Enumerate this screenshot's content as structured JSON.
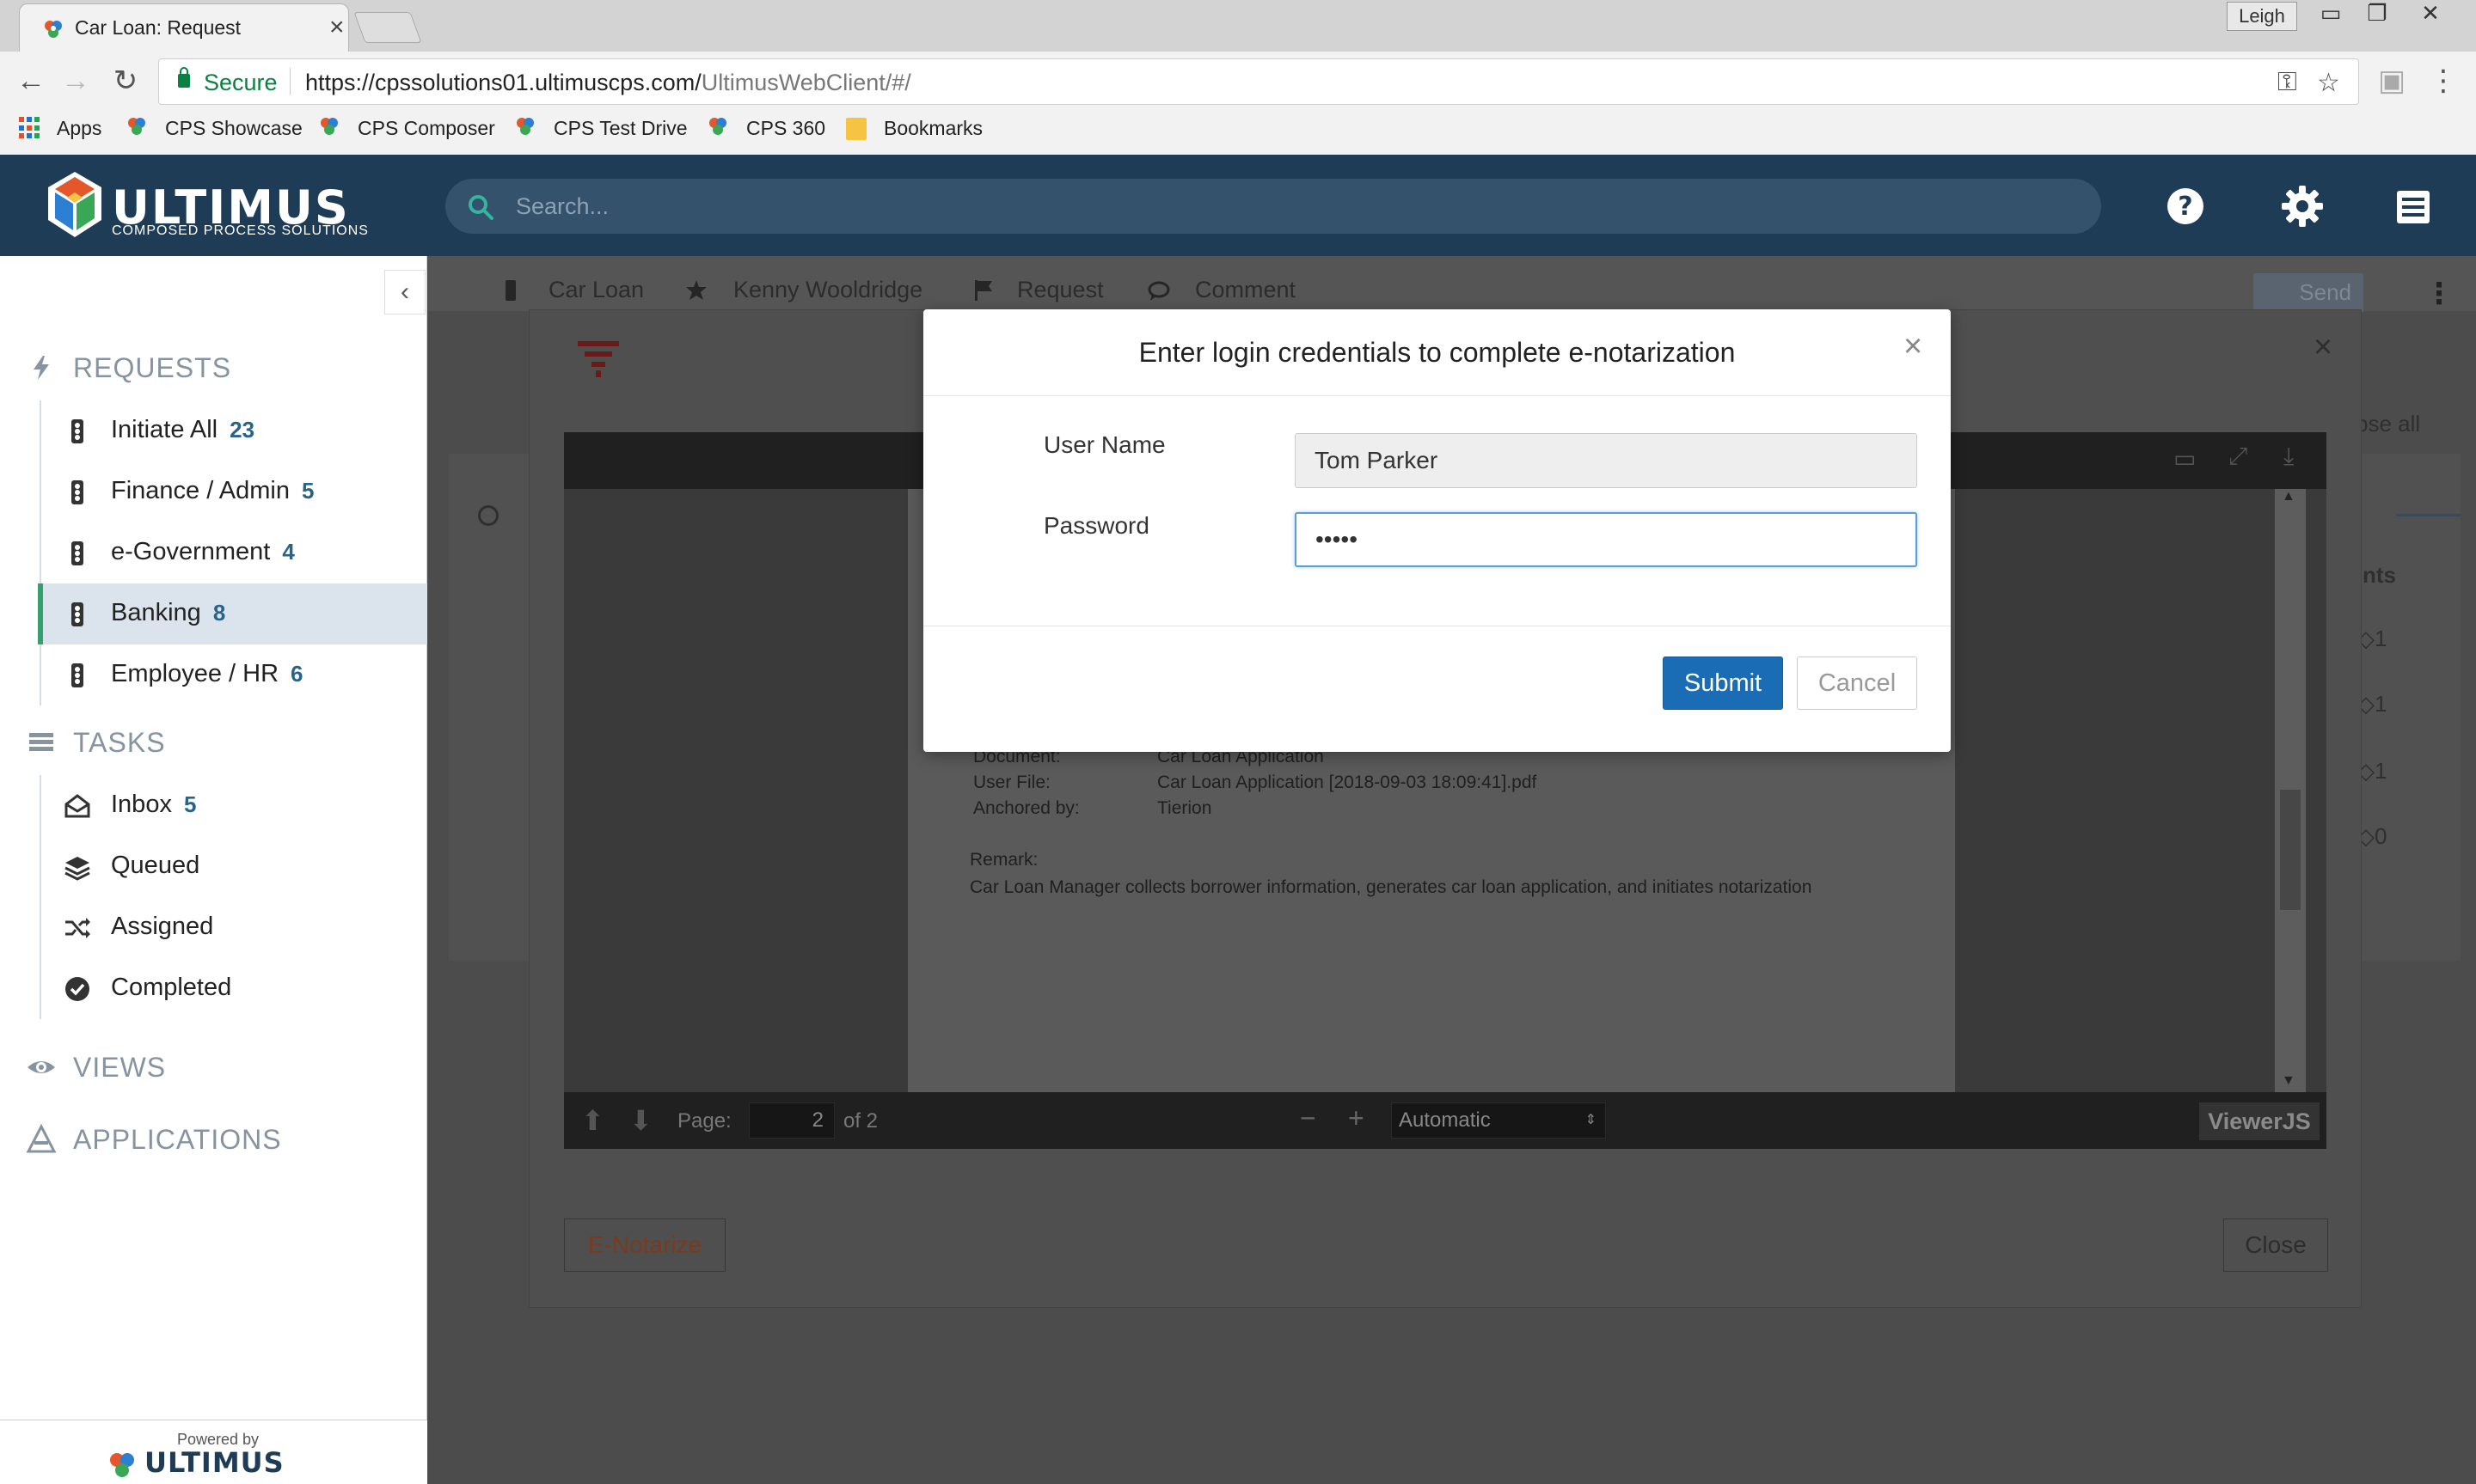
{
  "browser": {
    "tab_title": "Car Loan: Request",
    "tab_close": "×",
    "user_badge": "Leigh",
    "secure_label": "Secure",
    "url_host": "https://cpssolutions01.ultimuscps.com/",
    "url_path": "UltimusWebClient/#/",
    "bookmarks": [
      "Apps",
      "CPS Showcase",
      "CPS Composer",
      "CPS Test Drive",
      "CPS 360",
      "Bookmarks"
    ]
  },
  "header": {
    "logo_text": "ULTIMUS",
    "logo_subtext": "COMPOSED PROCESS SOLUTIONS",
    "search_placeholder": "Search..."
  },
  "sidebar": {
    "requests_label": "REQUESTS",
    "requests": [
      {
        "label": "Initiate All",
        "count": "23"
      },
      {
        "label": "Finance / Admin",
        "count": "5"
      },
      {
        "label": "e-Government",
        "count": "4"
      },
      {
        "label": "Banking",
        "count": "8"
      },
      {
        "label": "Employee / HR",
        "count": "6"
      }
    ],
    "tasks_label": "TASKS",
    "tasks": [
      {
        "label": "Inbox",
        "count": "5"
      },
      {
        "label": "Queued",
        "count": ""
      },
      {
        "label": "Assigned",
        "count": ""
      },
      {
        "label": "Completed",
        "count": ""
      }
    ],
    "views_label": "VIEWS",
    "applications_label": "APPLICATIONS",
    "powered_by": "Powered by",
    "powered_brand": "ULTIMUS"
  },
  "crumbs": {
    "process": "Car Loan",
    "user": "Kenny Wooldridge",
    "step": "Request",
    "comment": "Comment",
    "send": "Send"
  },
  "background": {
    "collapse_all": "pse all",
    "column_label": "nts",
    "counts": [
      "1",
      "1",
      "1",
      "0"
    ]
  },
  "viewer": {
    "doc_lines": [
      {
        "label": "Document:",
        "value": "Car Loan Application"
      },
      {
        "label": "User File:",
        "value": "Car Loan Application [2018-09-03 18:09:41].pdf"
      },
      {
        "label": "Anchored by:",
        "value": "Tierion"
      }
    ],
    "remark_label": "Remark:",
    "remark_text": "Car Loan Manager collects borrower information, generates car loan application, and initiates notarization",
    "page_label": "Page:",
    "page_value": "2",
    "page_of": "of 2",
    "zoom_value": "Automatic",
    "brand": "ViewerJS",
    "enotarize_button": "E-Notarize",
    "close_button": "Close"
  },
  "dialog": {
    "title": "Enter login credentials to complete e-notarization",
    "username_label": "User Name",
    "username_value": "Tom Parker",
    "password_label": "Password",
    "password_value": "•••••",
    "submit_label": "Submit",
    "cancel_label": "Cancel",
    "close_symbol": "×"
  },
  "colors": {
    "header_bg": "#1e3c56",
    "primary_button": "#1a6db5",
    "active_accent": "#35a06f",
    "count_color": "#27638a"
  }
}
